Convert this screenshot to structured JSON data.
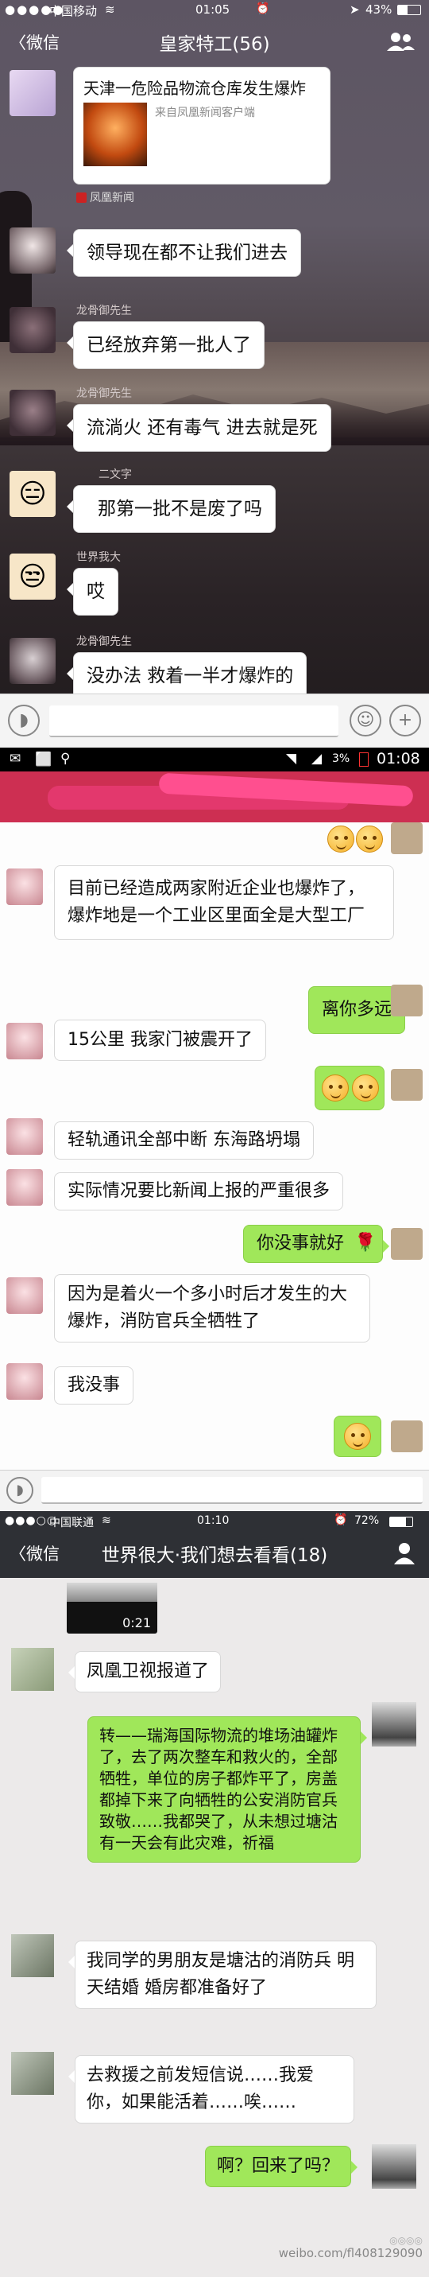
{
  "section1": {
    "status": {
      "carrier": "中国移动",
      "time": "01:05",
      "battery": "43%"
    },
    "nav": {
      "back": "微信",
      "title": "皇家特工(56)"
    },
    "news_card": {
      "title": "天津一危险品物流仓库发生爆炸",
      "source_line": "来自凤凰新闻客户端",
      "app_name": "凤凰新闻"
    },
    "messages": [
      {
        "sender": "",
        "text": "领导现在都不让我们进去"
      },
      {
        "sender": "龙骨御先生",
        "text": "已经放弃第一批人了"
      },
      {
        "sender": "龙骨御先生",
        "text": "流淌火 还有毒气 进去就是死"
      },
      {
        "sender": "二文字",
        "text": "那第一批不是废了吗"
      },
      {
        "sender": "世界我大",
        "text": "哎"
      },
      {
        "sender": "龙骨御先生",
        "text": "没办法 救着一半才爆炸的"
      }
    ]
  },
  "section2": {
    "status": {
      "battery": "3%",
      "time": "01:08"
    },
    "messages": [
      {
        "side": "in",
        "text": "目前已经造成两家附近企业也爆炸了，爆炸地是一个工业区里面全是大型工厂"
      },
      {
        "side": "out",
        "text": "离你多远"
      },
      {
        "side": "in",
        "text": "15公里 我家门被震开了"
      },
      {
        "side": "in",
        "text": "轻轨通讯全部中断 东海路坍塌"
      },
      {
        "side": "in",
        "text": "实际情况要比新闻上报的严重很多"
      },
      {
        "side": "out",
        "text": "你没事就好"
      },
      {
        "side": "in",
        "text": "因为是着火一个多小时后才发生的大爆炸，消防官兵全牺牲了"
      },
      {
        "side": "in",
        "text": "我没事"
      }
    ]
  },
  "section3": {
    "status": {
      "carrier": "中国联通",
      "time": "01:10",
      "battery": "72%"
    },
    "nav": {
      "back": "微信",
      "title": "世界很大·我们想去看看(18)"
    },
    "video_duration": "0:21",
    "messages": [
      {
        "side": "in",
        "text": "凤凰卫视报道了"
      },
      {
        "side": "out",
        "text": "转——瑞海国际物流的堆场油罐炸了，去了两次整车和救火的，全部牺牲，单位的房子都炸平了，房盖都掉下来了向牺牲的公安消防官兵致敬……我都哭了，从未想过塘沽有一天会有此灾难，祈福"
      },
      {
        "side": "in",
        "text": "我同学的男朋友是塘沽的消防兵 明天结婚 婚房都准备好了"
      },
      {
        "side": "in",
        "text": "去救援之前发短信说……我爱你，如果能活着……唉……"
      },
      {
        "side": "out",
        "text": "啊？回来了吗？"
      }
    ],
    "watermark": "weibo.com/fl408129090"
  }
}
